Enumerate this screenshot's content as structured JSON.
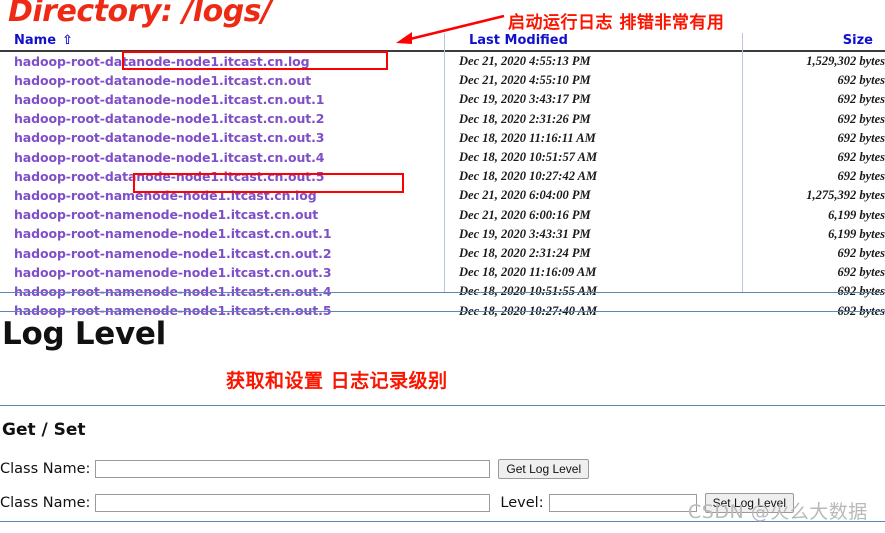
{
  "directory": {
    "title": "Directory: /logs/",
    "annotation_top": "启动运行日志  排错非常有用",
    "columns": {
      "name": "Name",
      "sort_arrow": "⇧",
      "last_modified": "Last Modified",
      "size": "Size"
    },
    "files": [
      {
        "name": "hadoop-root-datanode-node1.itcast.cn.log",
        "modified": "Dec 21, 2020 4:55:13 PM",
        "size": "1,529,302 bytes"
      },
      {
        "name": "hadoop-root-datanode-node1.itcast.cn.out",
        "modified": "Dec 21, 2020 4:55:10 PM",
        "size": "692 bytes"
      },
      {
        "name": "hadoop-root-datanode-node1.itcast.cn.out.1",
        "modified": "Dec 19, 2020 3:43:17 PM",
        "size": "692 bytes"
      },
      {
        "name": "hadoop-root-datanode-node1.itcast.cn.out.2",
        "modified": "Dec 18, 2020 2:31:26 PM",
        "size": "692 bytes"
      },
      {
        "name": "hadoop-root-datanode-node1.itcast.cn.out.3",
        "modified": "Dec 18, 2020 11:16:11 AM",
        "size": "692 bytes"
      },
      {
        "name": "hadoop-root-datanode-node1.itcast.cn.out.4",
        "modified": "Dec 18, 2020 10:51:57 AM",
        "size": "692 bytes"
      },
      {
        "name": "hadoop-root-datanode-node1.itcast.cn.out.5",
        "modified": "Dec 18, 2020 10:27:42 AM",
        "size": "692 bytes"
      },
      {
        "name": "hadoop-root-namenode-node1.itcast.cn.log",
        "modified": "Dec 21, 2020 6:04:00 PM",
        "size": "1,275,392 bytes"
      },
      {
        "name": "hadoop-root-namenode-node1.itcast.cn.out",
        "modified": "Dec 21, 2020 6:00:16 PM",
        "size": "6,199 bytes"
      },
      {
        "name": "hadoop-root-namenode-node1.itcast.cn.out.1",
        "modified": "Dec 19, 2020 3:43:31 PM",
        "size": "6,199 bytes"
      },
      {
        "name": "hadoop-root-namenode-node1.itcast.cn.out.2",
        "modified": "Dec 18, 2020 2:31:24 PM",
        "size": "692 bytes"
      },
      {
        "name": "hadoop-root-namenode-node1.itcast.cn.out.3",
        "modified": "Dec 18, 2020 11:16:09 AM",
        "size": "692 bytes"
      },
      {
        "name": "hadoop-root-namenode-node1.itcast.cn.out.4",
        "modified": "Dec 18, 2020 10:51:55 AM",
        "size": "692 bytes"
      },
      {
        "name": "hadoop-root-namenode-node1.itcast.cn.out.5",
        "modified": "Dec 18, 2020 10:27:40 AM",
        "size": "692 bytes"
      }
    ]
  },
  "log_level": {
    "title": "Log Level",
    "annotation_mid": "获取和设置 日志记录级别",
    "getset_title": "Get / Set",
    "class_name_label_1": "Class Name:",
    "class_name_value_1": "",
    "get_button": "Get Log Level",
    "class_name_label_2": "Class Name:",
    "class_name_value_2": "",
    "level_label": "Level:",
    "level_value": "",
    "set_button": "Set Log Level"
  },
  "watermark": "CSDN @火么大数据",
  "colors": {
    "heading_red": "#ee2a14",
    "annotation_red": "#fb1500",
    "link_purple": "#7f4fc9",
    "header_blue": "#1111cc",
    "rule_blue": "#5b87b5",
    "highlight_box": "#ff0000"
  }
}
